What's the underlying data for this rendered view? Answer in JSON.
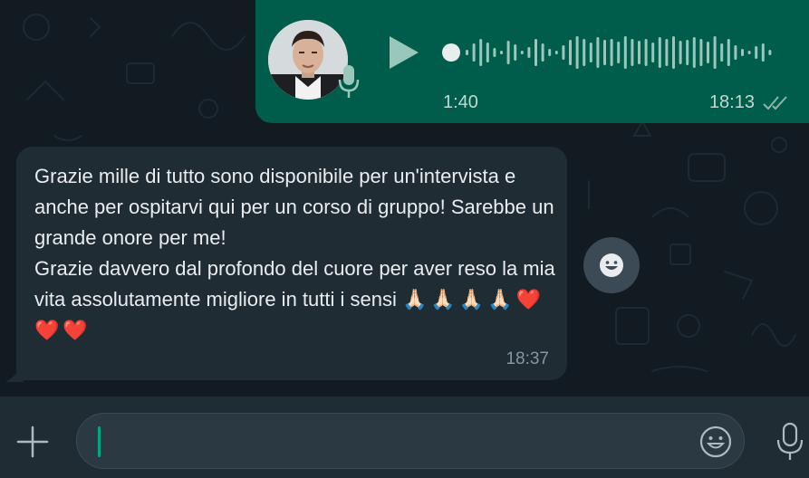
{
  "voice_message": {
    "duration": "1:40",
    "time": "18:13",
    "status": "read",
    "icons": {
      "play": "play-icon",
      "mic": "microphone-icon",
      "ticks": "double-check-icon"
    },
    "colors": {
      "bubble": "#005c4b",
      "waveform": "#9ac7bb"
    }
  },
  "text_message": {
    "text": "Grazie mille di tutto sono disponibile per un'intervista e anche per ospitarvi qui per un corso di gruppo! Sarebbe un grande onore per me!\nGrazie davvero dal profondo del cuore per aver reso la mia vita assolutamente migliore in tutti i sensi",
    "emojis": "🙏🏻🙏🏻🙏🏻🙏🏻❤️❤️❤️",
    "time": "18:37",
    "colors": {
      "bubble": "#202c33",
      "text": "#e9edef"
    }
  },
  "reaction_button": {
    "icon": "smiley-icon"
  },
  "composer": {
    "value": "",
    "icons": {
      "attach": "plus-icon",
      "emoji": "smiley-icon",
      "voice": "microphone-icon"
    },
    "colors": {
      "caret": "#00a884"
    }
  }
}
